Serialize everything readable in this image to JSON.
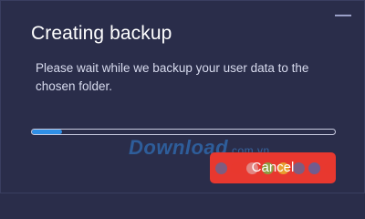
{
  "dialog": {
    "title": "Creating backup",
    "message": "Please wait while we backup your user data to the chosen folder.",
    "progress": 0.1,
    "cancel_label": "Cancel"
  },
  "watermark": {
    "brand": "Download",
    "domain": ".com.vn"
  },
  "colors": {
    "background": "#2a2d4a",
    "accent": "#2f8fe6",
    "cancel": "#e8382f",
    "dot_colors": [
      "#5b6a9c",
      "#e8382f",
      "#e0a0a0",
      "#6fbf4a",
      "#e8c030",
      "#5b6a9c",
      "#4a68b0",
      "#e8382f"
    ]
  }
}
